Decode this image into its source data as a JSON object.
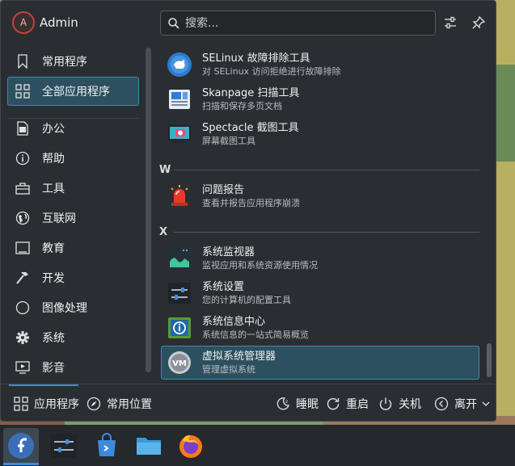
{
  "user": {
    "name": "Admin",
    "initial": "A"
  },
  "search": {
    "placeholder": "搜索..."
  },
  "categories": [
    {
      "label": "常用程序",
      "icon": "bookmark-icon"
    },
    {
      "label": "全部应用程序",
      "icon": "grid-icon"
    },
    {
      "label": "办公",
      "icon": "document-icon"
    },
    {
      "label": "帮助",
      "icon": "info-icon"
    },
    {
      "label": "工具",
      "icon": "toolbox-icon"
    },
    {
      "label": "互联网",
      "icon": "globe-icon"
    },
    {
      "label": "教育",
      "icon": "education-icon"
    },
    {
      "label": "开发",
      "icon": "hammer-icon"
    },
    {
      "label": "图像处理",
      "icon": "palette-icon"
    },
    {
      "label": "系统",
      "icon": "gear-icon"
    },
    {
      "label": "影音",
      "icon": "video-icon"
    }
  ],
  "apps_s": [
    {
      "name": "SELinux 故障排除工具",
      "desc": "对 SELinux 访问拒绝进行故障排除",
      "icon": "selinux-icon"
    },
    {
      "name": "Skanpage 扫描工具",
      "desc": "扫描和保存多页文档",
      "icon": "scanner-icon"
    },
    {
      "name": "Spectacle 截图工具",
      "desc": "屏幕截图工具",
      "icon": "screenshot-icon"
    }
  ],
  "section_w": "W",
  "apps_w": [
    {
      "name": "问题报告",
      "desc": "查看并报告应用程序崩溃",
      "icon": "alarm-icon"
    }
  ],
  "section_x": "X",
  "apps_x": [
    {
      "name": "系统监视器",
      "desc": "监视应用和系统资源使用情况",
      "icon": "system-monitor-icon"
    },
    {
      "name": "系统设置",
      "desc": "您的计算机的配置工具",
      "icon": "system-settings-icon"
    },
    {
      "name": "系统信息中心",
      "desc": "系统信息的一站式简易概览",
      "icon": "info-center-icon"
    },
    {
      "name": "虚拟系统管理器",
      "desc": "管理虚拟系统",
      "icon": "virt-manager-icon"
    }
  ],
  "footer": {
    "apps_tab": "应用程序",
    "places_tab": "常用位置",
    "sleep": "睡眠",
    "restart": "重启",
    "shutdown": "关机",
    "leave": "离开"
  },
  "taskbar": [
    "fedora-icon",
    "system-settings-icon",
    "discover-store-icon",
    "folder-icon",
    "firefox-icon"
  ],
  "colors": {
    "accent": "#3d8ae0",
    "highlight": "#2d5060",
    "panel": "#2a2e32"
  }
}
